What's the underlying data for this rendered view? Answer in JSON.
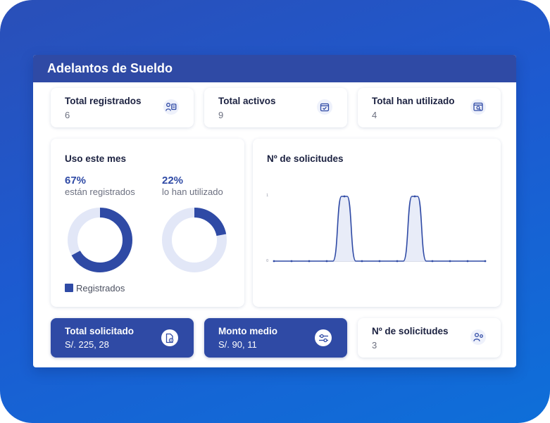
{
  "panel": {
    "title": "Adelantos de Sueldo"
  },
  "stats_top": [
    {
      "label": "Total registrados",
      "value": "6",
      "icon": "users-doc-icon"
    },
    {
      "label": "Total activos",
      "value": "9",
      "icon": "calendar-check-icon"
    },
    {
      "label": "Total han utilizado",
      "value": "4",
      "icon": "browser-search-icon"
    }
  ],
  "usage": {
    "title": "Uso este mes",
    "registered": {
      "percent": "67%",
      "label": "están registrados",
      "fraction": 0.67
    },
    "used": {
      "percent": "22%",
      "label": "lo han utilizado",
      "fraction": 0.22
    },
    "legend_label": "Registrados",
    "colors": {
      "fill": "#2f4aa5",
      "track": "#e2e7f7"
    }
  },
  "requests_chart": {
    "title": "Nº de solicitudes",
    "y_ticks": [
      "1",
      "0"
    ]
  },
  "chart_data": {
    "type": "area",
    "title": "Nº de solicitudes",
    "xlabel": "",
    "ylabel": "",
    "ylim": [
      0,
      1
    ],
    "y_ticks": [
      0,
      1
    ],
    "x": [
      0,
      1,
      2,
      3,
      4,
      5,
      6,
      7,
      8,
      9,
      10,
      11,
      12
    ],
    "series": [
      {
        "values": [
          0,
          0,
          0,
          0,
          1,
          0,
          0,
          0,
          1,
          0,
          0,
          0,
          0
        ]
      }
    ]
  },
  "stats_bottom": [
    {
      "label": "Total solicitado",
      "value": "S/. 225, 28",
      "icon": "file-coin-icon",
      "dark": true
    },
    {
      "label": "Monto medio",
      "value": "S/. 90, 11",
      "icon": "sliders-icon",
      "dark": true
    },
    {
      "label": "Nº de solicitudes",
      "value": "3",
      "icon": "user-settings-icon",
      "dark": false
    }
  ]
}
